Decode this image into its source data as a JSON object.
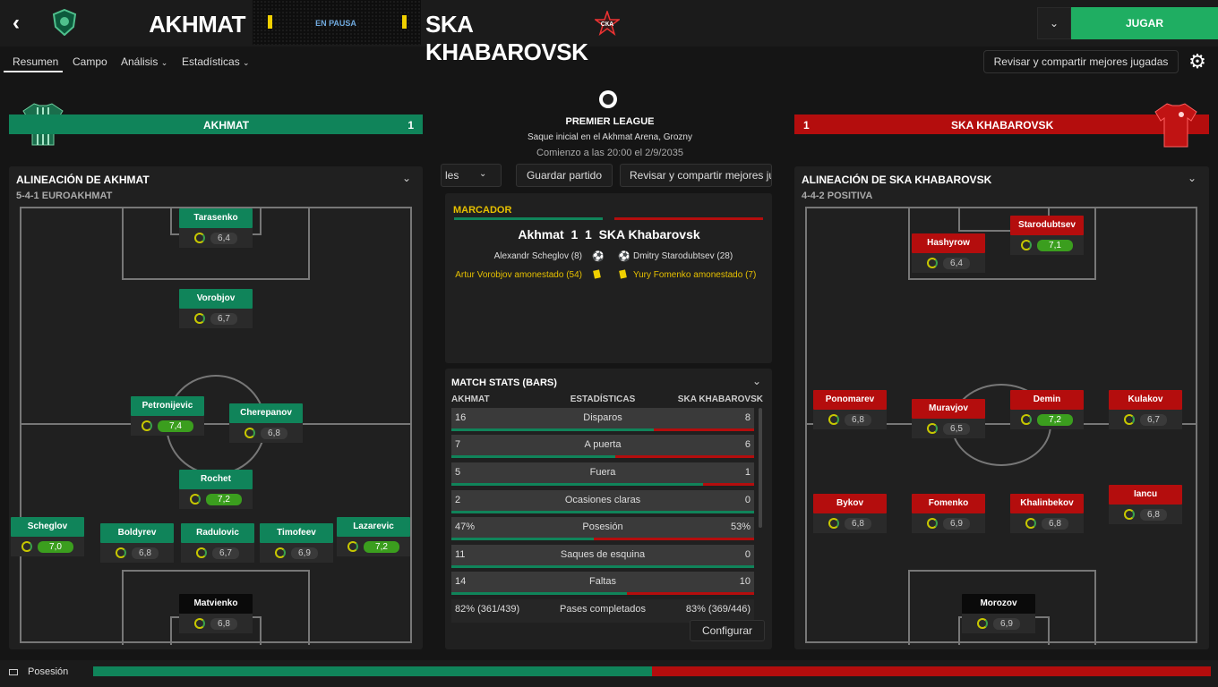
{
  "header": {
    "home_team": "AKHMAT",
    "away_team": "SKA KHABAROVSK",
    "status": "EN PAUSA",
    "play_label": "JUGAR"
  },
  "nav": {
    "tabs": [
      "Resumen",
      "Campo",
      "Análisis",
      "Estadísticas"
    ],
    "review_label": "Revisar y compartir mejores jugadas"
  },
  "home": {
    "banner_name": "AKHMAT",
    "score": "1",
    "lineup_title": "ALINEACIÓN DE AKHMAT",
    "formation": "5-4-1 EUROAKHMAT",
    "players": [
      {
        "name": "Tarasenko",
        "rating": "6,4",
        "good": false
      },
      {
        "name": "Vorobjov",
        "rating": "6,7",
        "good": false
      },
      {
        "name": "Petronijevic",
        "rating": "7,4",
        "good": true
      },
      {
        "name": "Cherepanov",
        "rating": "6,8",
        "good": false
      },
      {
        "name": "Rochet",
        "rating": "7,2",
        "good": true
      },
      {
        "name": "Scheglov",
        "rating": "7,0",
        "good": true
      },
      {
        "name": "Boldyrev",
        "rating": "6,8",
        "good": false
      },
      {
        "name": "Radulovic",
        "rating": "6,7",
        "good": false
      },
      {
        "name": "Timofeev",
        "rating": "6,9",
        "good": false
      },
      {
        "name": "Lazarevic",
        "rating": "7,2",
        "good": true
      },
      {
        "name": "Matvienko",
        "rating": "6,8",
        "good": false
      }
    ]
  },
  "away": {
    "banner_name": "SKA KHABAROVSK",
    "score": "1",
    "lineup_title": "ALINEACIÓN DE SKA KHABAROVSK",
    "formation": "4-4-2 POSITIVA",
    "players": [
      {
        "name": "Starodubtsev",
        "rating": "7,1",
        "good": true
      },
      {
        "name": "Hashyrow",
        "rating": "6,4",
        "good": false
      },
      {
        "name": "Ponomarev",
        "rating": "6,8",
        "good": false
      },
      {
        "name": "Muravjov",
        "rating": "6,5",
        "good": false
      },
      {
        "name": "Demin",
        "rating": "7,2",
        "good": true
      },
      {
        "name": "Kulakov",
        "rating": "6,7",
        "good": false
      },
      {
        "name": "Bykov",
        "rating": "6,8",
        "good": false
      },
      {
        "name": "Fomenko",
        "rating": "6,9",
        "good": false
      },
      {
        "name": "Khalinbekov",
        "rating": "6,8",
        "good": false
      },
      {
        "name": "Iancu",
        "rating": "6,8",
        "good": false
      },
      {
        "name": "Morozov",
        "rating": "6,9",
        "good": false
      }
    ]
  },
  "match": {
    "competition": "PREMIER LEAGUE",
    "venue": "Saque inicial en el Akhmat Arena, Grozny",
    "kickoff": "Comienzo a las 20:00 el 2/9/2035",
    "dropdown_partial": "les",
    "save_label": "Guardar partido",
    "review_label": "Revisar y compartir mejores ju"
  },
  "scoreboard": {
    "title": "MARCADOR",
    "line": "Akhmat  1  1  SKA Khabarovsk",
    "home_goal": "Alexandr Scheglov (8)",
    "away_goal": "Dmitry Starodubtsev (28)",
    "home_card": "Artur Vorobjov amonestado (54)",
    "away_card": "Yury Fomenko amonestado (7)"
  },
  "stats": {
    "title": "MATCH STATS (BARS)",
    "col_home": "AKHMAT",
    "col_mid": "ESTADÍSTICAS",
    "col_away": "SKA KHABAROVSK",
    "configure_label": "Configurar",
    "rows": [
      {
        "home": "16",
        "label": "Disparos",
        "away": "8",
        "home_frac": 0.67
      },
      {
        "home": "7",
        "label": "A puerta",
        "away": "6",
        "home_frac": 0.54
      },
      {
        "home": "5",
        "label": "Fuera",
        "away": "1",
        "home_frac": 0.83
      },
      {
        "home": "2",
        "label": "Ocasiones claras",
        "away": "0",
        "home_frac": 1.0
      },
      {
        "home": "47%",
        "label": "Posesión",
        "away": "53%",
        "home_frac": 0.47
      },
      {
        "home": "11",
        "label": "Saques de esquina",
        "away": "0",
        "home_frac": 1.0
      },
      {
        "home": "14",
        "label": "Faltas",
        "away": "10",
        "home_frac": 0.58
      },
      {
        "home": "82% (361/439)",
        "label": "Pases completados",
        "away": "83% (369/446)",
        "home_frac": 0.5
      }
    ]
  },
  "footer": {
    "possession_label": "Posesión",
    "home_possession": 0.5
  },
  "colors": {
    "home": "#10845a",
    "away": "#b40d0d",
    "accent": "#1fae62"
  }
}
